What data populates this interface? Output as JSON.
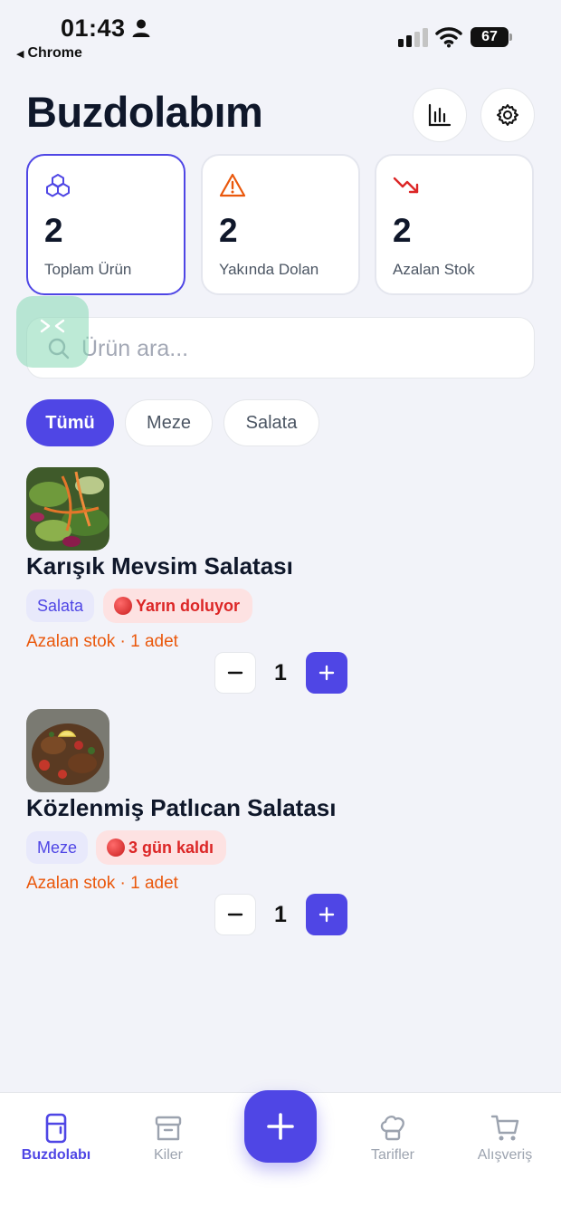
{
  "status_bar": {
    "time": "01:43",
    "back_app": "Chrome",
    "battery": "67"
  },
  "header": {
    "title": "Buzdolabım",
    "stats_icon": "bar-chart-icon",
    "settings_icon": "gear-icon"
  },
  "stats": [
    {
      "value": "2",
      "label": "Toplam Ürün",
      "icon": "cubes-icon",
      "color": "#4f46e5"
    },
    {
      "value": "2",
      "label": "Yakında Dolan",
      "icon": "warning-icon",
      "color": "#ea580c"
    },
    {
      "value": "2",
      "label": "Azalan Stok",
      "icon": "trending-down-icon",
      "color": "#dc2626"
    }
  ],
  "search": {
    "placeholder": "Ürün ara...",
    "value": ""
  },
  "filters": [
    {
      "label": "Tümü",
      "active": true
    },
    {
      "label": "Meze",
      "active": false
    },
    {
      "label": "Salata",
      "active": false
    }
  ],
  "items": [
    {
      "name": "Karışık Mevsim Salatası",
      "category": "Salata",
      "expiry": "Yarın doluyor",
      "stock_note": "Azalan stok · 1 adet",
      "quantity": "1"
    },
    {
      "name": "Közlenmiş Patlıcan Salatası",
      "category": "Meze",
      "expiry": "3 gün kaldı",
      "stock_note": "Azalan stok · 1 adet",
      "quantity": "1"
    }
  ],
  "tabbar": [
    {
      "label": "Buzdolabı",
      "icon": "fridge-icon",
      "active": true
    },
    {
      "label": "Kiler",
      "icon": "archive-box-icon",
      "active": false
    },
    {
      "label": "Tarifler",
      "icon": "chef-hat-icon",
      "active": false
    },
    {
      "label": "Alışveriş",
      "icon": "cart-icon",
      "active": false
    }
  ],
  "fab": {
    "icon": "plus-icon"
  },
  "colors": {
    "accent": "#4f46e5",
    "warning": "#ea580c",
    "danger": "#dc2626",
    "background": "#f2f3f9"
  }
}
